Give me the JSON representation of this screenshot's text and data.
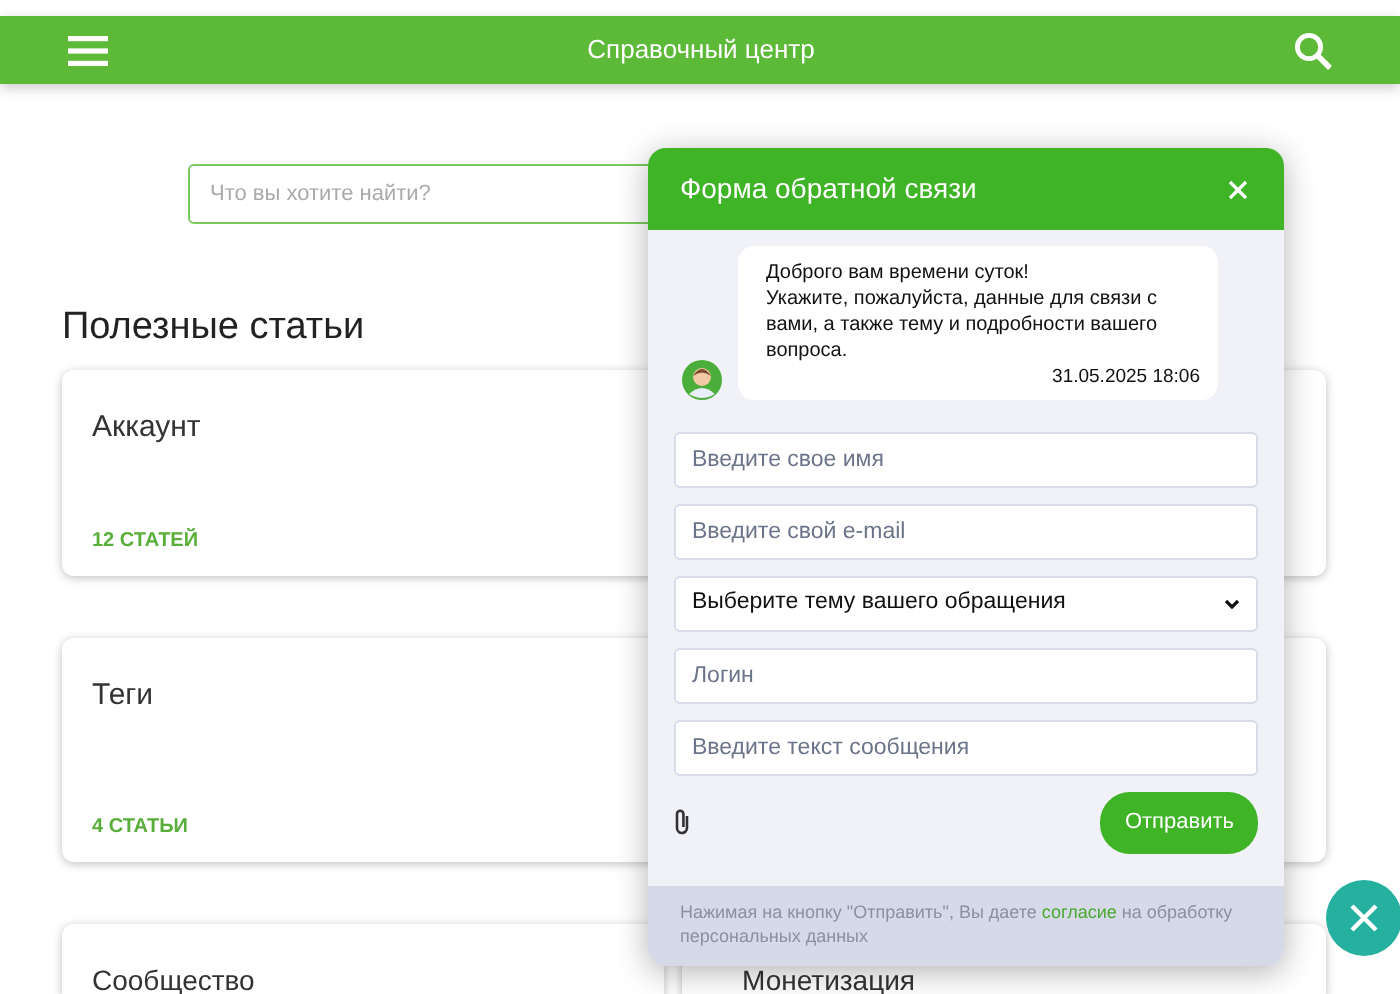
{
  "header": {
    "title": "Справочный центр"
  },
  "search": {
    "placeholder": "Что вы хотите найти?"
  },
  "section_title": "Полезные статьи",
  "left_cards": [
    {
      "title": "Аккаунт",
      "count": "12 СТАТЕЙ"
    },
    {
      "title": "Теги",
      "count": "4 СТАТЬИ"
    },
    {
      "title": "Сообщество"
    }
  ],
  "right_cards": [
    {
      "title": "Монетизация"
    }
  ],
  "feedback": {
    "title": "Форма обратной связи",
    "message": {
      "lines": [
        "Доброго вам времени суток!",
        "Укажите, пожалуйста, данные для связи с вами, а также тему и подробности вашего вопроса."
      ],
      "time": "31.05.2025 18:06"
    },
    "fields": [
      {
        "kind": "input",
        "placeholder": "Введите свое имя"
      },
      {
        "kind": "input",
        "placeholder": "Введите свой e-mail"
      },
      {
        "kind": "select",
        "value": "Выберите тему вашего обращения"
      },
      {
        "kind": "input",
        "placeholder": "Логин"
      },
      {
        "kind": "input",
        "placeholder": "Введите текст сообщения"
      }
    ],
    "submit": "Отправить",
    "consent": {
      "before": "Нажимая на кнопку \"Отправить\", Вы даете ",
      "link": "согласие",
      "after": " на обработку персональных данных"
    }
  }
}
